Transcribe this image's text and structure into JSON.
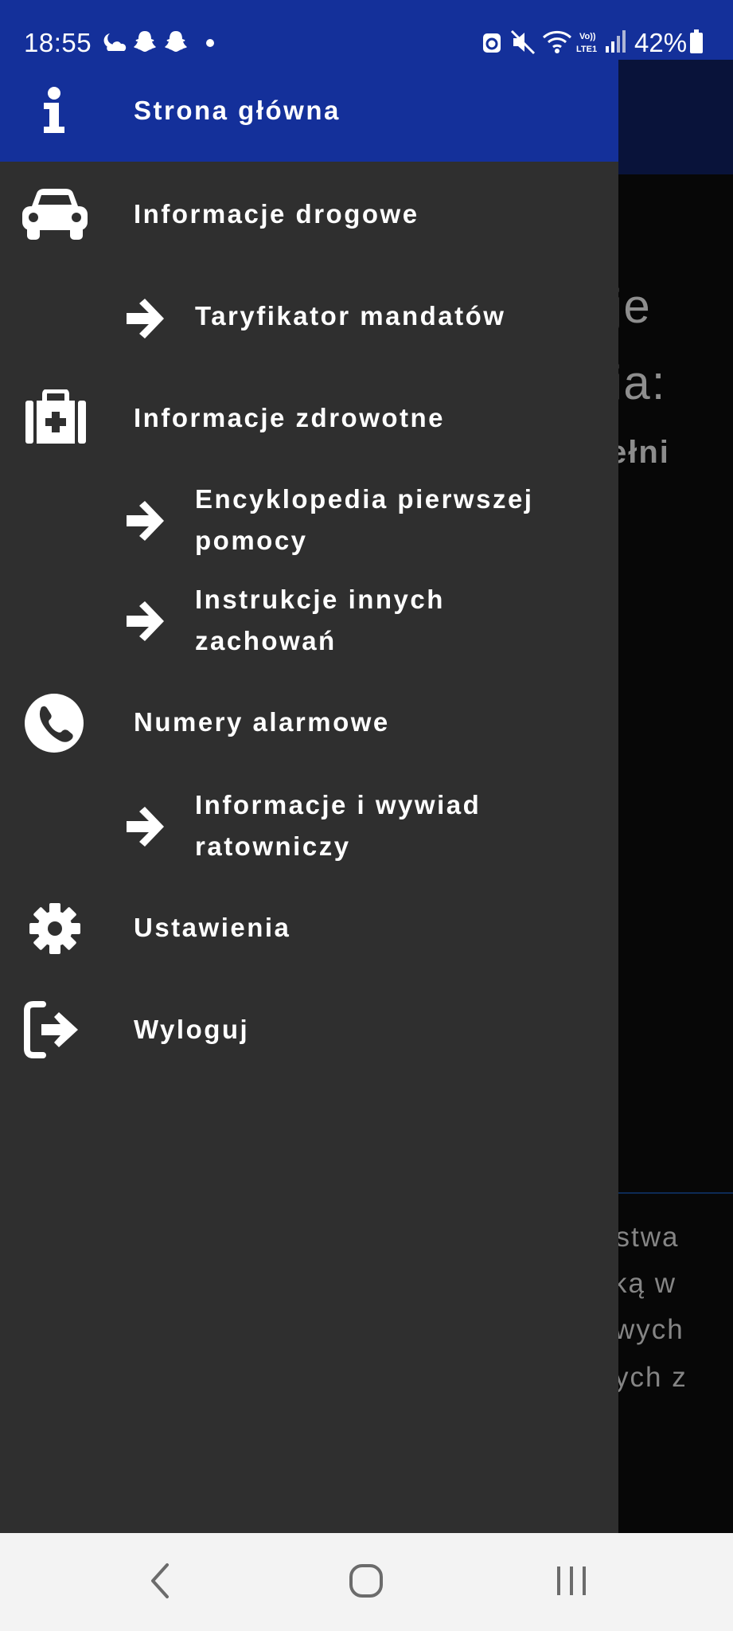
{
  "status_bar": {
    "time": "18:55",
    "battery": "42%",
    "left_icons": [
      "weather-icon",
      "snapchat-icon",
      "snapchat-icon",
      "dot-icon"
    ],
    "right_icons": [
      "recycle-icon",
      "mute-icon",
      "wifi-icon",
      "volte-icon",
      "signal-icon",
      "battery-icon"
    ]
  },
  "background": {
    "line1": "je",
    "line2": "ia:",
    "line3": "ełni",
    "para": [
      "ństwa",
      "ką w",
      "wych",
      "ych z"
    ]
  },
  "drawer": {
    "items": [
      {
        "label": "Strona główna",
        "icon": "info-icon"
      },
      {
        "label": "Informacje drogowe",
        "icon": "car-icon"
      },
      {
        "label": "Taryfikator mandatów",
        "icon": "arrow-right-icon"
      },
      {
        "label": "Informacje zdrowotne",
        "icon": "medkit-icon"
      },
      {
        "label": "Encyklopedia pierwszej pomocy",
        "icon": "arrow-right-icon"
      },
      {
        "label": "Instrukcje innych zachowań",
        "icon": "arrow-right-icon"
      },
      {
        "label": "Numery alarmowe",
        "icon": "phone-icon"
      },
      {
        "label": "Informacje i wywiad ratowniczy",
        "icon": "arrow-right-icon"
      },
      {
        "label": "Ustawienia",
        "icon": "gear-icon"
      },
      {
        "label": "Wyloguj",
        "icon": "logout-icon"
      }
    ]
  },
  "nav_bar": [
    "back-icon",
    "home-icon",
    "recents-icon"
  ],
  "colors": {
    "accent": "#14309a",
    "drawer_bg": "#2f2f2f",
    "nav_bg": "#f3f3f3"
  }
}
